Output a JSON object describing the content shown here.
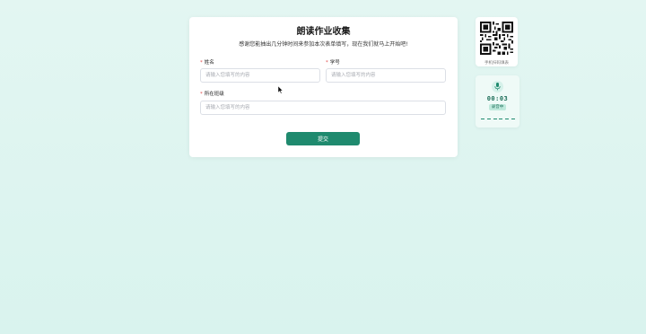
{
  "form": {
    "title": "朗读作业收集",
    "subtitle": "感谢您能抽出几分钟时间来参加本次表单填写，现在我们就马上开始吧!",
    "fields": [
      {
        "label": "姓名",
        "placeholder": "请输入您填写的内容",
        "required": true
      },
      {
        "label": "学号",
        "placeholder": "请输入您填写的内容",
        "required": true
      },
      {
        "label": "所在班级",
        "placeholder": "请输入您填写的内容",
        "required": true
      }
    ],
    "submit_label": "提交"
  },
  "qr": {
    "caption": "手机扫码填表"
  },
  "recorder": {
    "timer": "00:03",
    "status": "录音中"
  },
  "colors": {
    "accent": "#1f8a6e",
    "background": "#e3f6f2",
    "required": "#e04a4a"
  }
}
